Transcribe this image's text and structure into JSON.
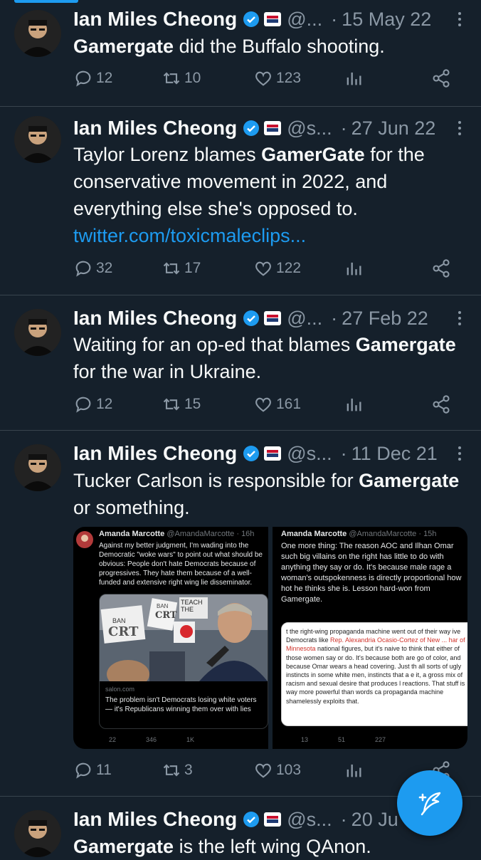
{
  "tweets": [
    {
      "name": "Ian Miles Cheong",
      "handle": "@...",
      "date": "15 May 22",
      "text_bold": "Gamergate",
      "text_rest": " did the Buffalo shooting.",
      "replies": "12",
      "retweets": "10",
      "likes": "123"
    },
    {
      "name": "Ian Miles Cheong",
      "handle": "@s...",
      "date": "27 Jun 22",
      "text_pre": "Taylor Lorenz blames ",
      "text_bold": "GamerGate",
      "text_rest": " for the conservative movement in 2022, and everything else she's opposed to.",
      "link": "twitter.com/toxicmaleclips...",
      "replies": "32",
      "retweets": "17",
      "likes": "122"
    },
    {
      "name": "Ian Miles Cheong",
      "handle": "@...",
      "date": "27 Feb 22",
      "text_pre": "Waiting for an op-ed that blames ",
      "text_bold": "Gamergate",
      "text_rest": " for the war in Ukraine.",
      "replies": "12",
      "retweets": "15",
      "likes": "161"
    },
    {
      "name": "Ian Miles Cheong",
      "handle": "@s...",
      "date": "11 Dec 21",
      "text_pre": "Tucker Carlson is responsible for ",
      "text_bold": "Gamergate",
      "text_rest": " or something.",
      "replies": "11",
      "retweets": "3",
      "likes": "103"
    },
    {
      "name": "Ian Miles Cheong",
      "handle": "@s...",
      "date": "20 Ju",
      "text_bold": "Gamergate",
      "text_rest": " is the left wing QAnon."
    }
  ],
  "media": {
    "left": {
      "name": "Amanda Marcotte",
      "handle": "@AmandaMarcotte · 16h",
      "text": "Against my better judgment, I'm wading into the Democratic \"woke wars\" to point out what should be obvious: People don't hate Democrats because of progressives. They hate them because of a well-funded and extensive right wing lie disseminator.",
      "sign1": "BAN",
      "sign2": "CRT",
      "sign3": "BAN",
      "sign4": "CRT",
      "sign5": "TEACH THE",
      "source": "salon.com",
      "card_title": "The problem isn't Democrats losing white voters — it's Republicans winning them over with lies",
      "replies": "22",
      "retweets": "346",
      "likes": "1K"
    },
    "right": {
      "name": "Amanda Marcotte",
      "handle": "@AmandaMarcotte · 15h",
      "text": "One more thing: The reason AOC and Ilhan Omar such big villains on the right has little to do with anything they say or do. It's because male rage a woman's outspokenness is directly proportional how hot he thinks she is. Lesson hard-won from Gamergate.",
      "quote_pre": "t the right-wing propaganda machine went out of their way ive Democrats like ",
      "quote_link": "Rep. Alexandria Ocasio-Cortez of New ... har of Minnesota",
      "quote_rest": " national figures, but it's naive to think that either of those women say or do. It's because both are go of color, and because Omar wears a head covering. Just th all sorts of ugly instincts in some white men, instincts that a e it, a gross mix of racism and sexual desire that produces l reactions. That stuff is way more powerful than words ca propaganda machine shamelessly exploits that.",
      "replies": "13",
      "retweets": "51",
      "likes": "227"
    }
  },
  "colors": {
    "background": "#15202b",
    "accent": "#1d9bf0",
    "muted": "#8b98a5",
    "divider": "#38444d"
  }
}
